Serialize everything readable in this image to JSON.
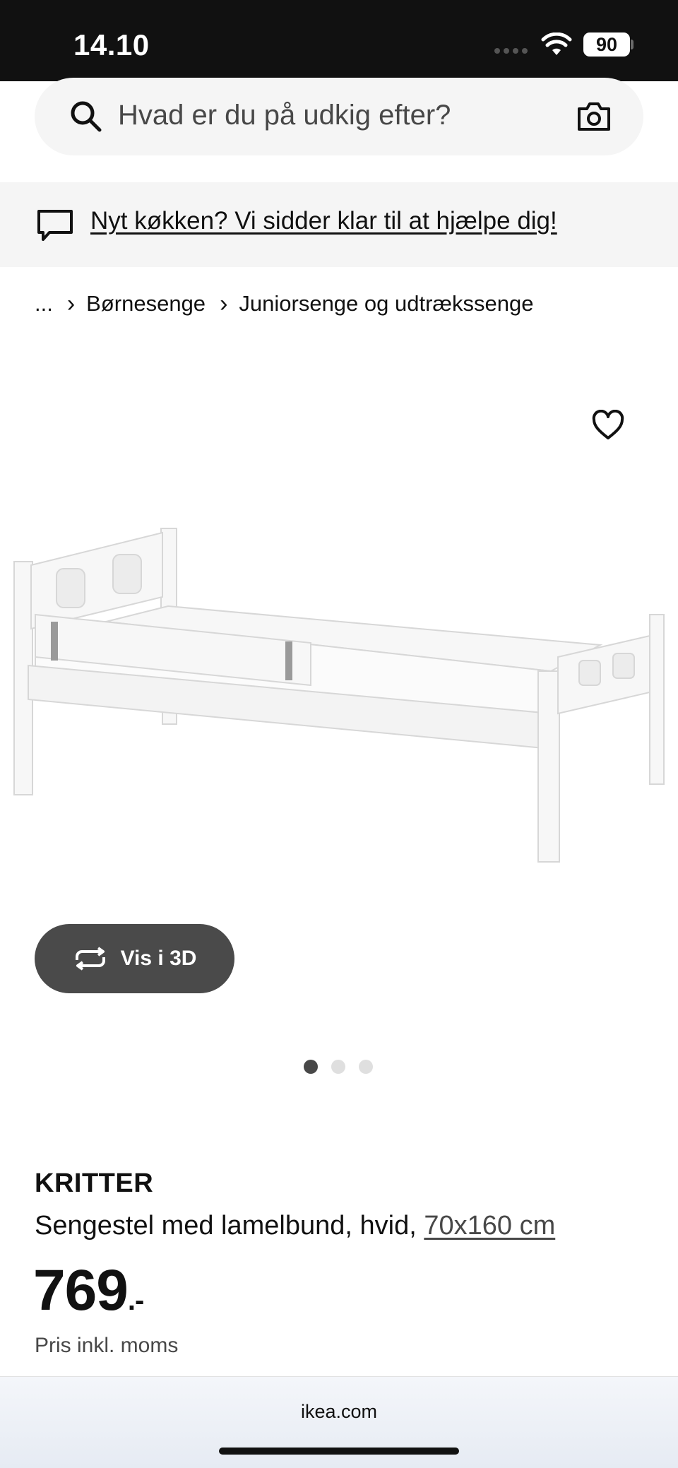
{
  "status_bar": {
    "time": "14.10",
    "battery": "90"
  },
  "search": {
    "placeholder": "Hvad er du på udkig efter?"
  },
  "help_banner": {
    "text": "Nyt køkken? Vi sidder klar til at hjælpe dig!"
  },
  "breadcrumb": {
    "ellipsis": "...",
    "items": [
      "Børnesenge",
      "Juniorsenge og udtrækssenge"
    ]
  },
  "gallery": {
    "view_3d_label": "Vis i 3D",
    "slide_count": 3,
    "active_slide": 1
  },
  "product": {
    "name": "KRITTER",
    "description": "Sengestel med lamelbund, hvid, ",
    "size_link": "70x160 cm",
    "price": "769",
    "price_suffix": ".-",
    "price_note": "Pris inkl. moms"
  },
  "browser": {
    "url": "ikea.com"
  },
  "icons": {
    "search": "search-icon",
    "camera": "camera-icon",
    "chat": "chat-icon",
    "favorite": "heart-icon",
    "rotate_3d": "rotate-icon"
  },
  "colors": {
    "button_dark": "#4a4a4a",
    "status_bar": "#111111",
    "banner_bg": "#f5f5f5"
  }
}
